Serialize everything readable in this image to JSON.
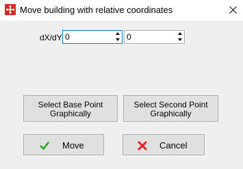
{
  "window": {
    "title": "Move building with relative coordinates",
    "close_glyph": "close-icon",
    "icon": "move-arrows-icon"
  },
  "form": {
    "label": "dX/dY:",
    "dx_value": "0",
    "dy_value": "0"
  },
  "buttons": {
    "select_base_line1": "Select Base Point",
    "select_base_line2": "Graphically",
    "select_second_line1": "Select Second Point",
    "select_second_line2": "Graphically",
    "move": "Move",
    "cancel": "Cancel"
  },
  "colors": {
    "accent": "#0078d7",
    "check_green": "#22a61e",
    "cancel_red": "#e0261f",
    "title_icon_red": "#d6281f"
  }
}
